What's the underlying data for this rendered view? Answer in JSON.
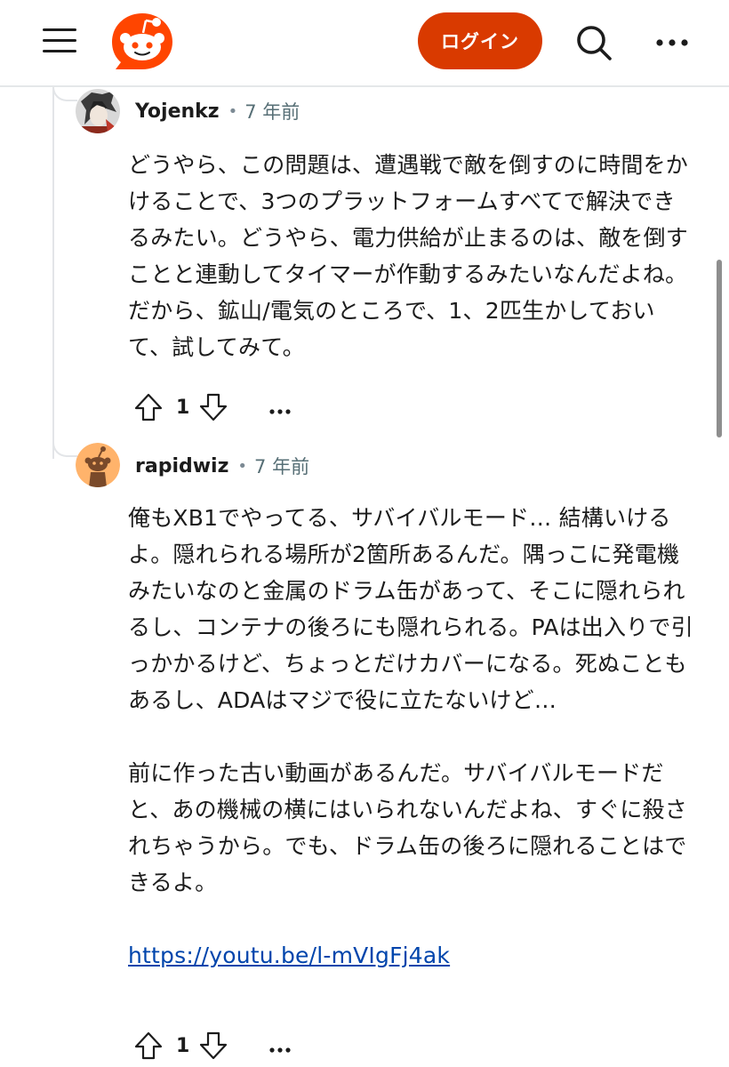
{
  "header": {
    "login_label": "ログイン",
    "icons": {
      "menu": "hamburger-menu-icon",
      "logo": "reddit-logo-icon",
      "search": "search-icon",
      "more": "more-horizontal-icon"
    },
    "colors": {
      "accent": "#d93a00",
      "logo_orange": "#ff4500"
    }
  },
  "comments": [
    {
      "username": "Yojenkz",
      "separator": "•",
      "time": "7 年前",
      "paragraphs": [
        "どうやら、この問題は、遭遇戦で敵を倒すのに時間をかけることで、3つのプラットフォームすべてで解決できるみたい。どうやら、電力供給が止まるのは、敵を倒すことと連動してタイマーが作動するみたいなんだよね。だから、鉱山/電気のところで、1、2匹生かしておいて、試してみて。"
      ],
      "link": "",
      "score": "1"
    },
    {
      "username": "rapidwiz",
      "separator": "•",
      "time": "7 年前",
      "paragraphs": [
        "俺もXB1でやってる、サバイバルモード… 結構いけるよ。隠れられる場所が2箇所あるんだ。隅っこに発電機みたいなのと金属のドラム缶があって、そこに隠れられるし、コンテナの後ろにも隠れられる。PAは出入りで引っかかるけど、ちょっとだけカバーになる。死ぬこともあるし、ADAはマジで役に立たないけど…",
        "前に作った古い動画があるんだ。サバイバルモードだと、あの機械の横にはいられないんだよね、すぐに殺されちゃうから。でも、ドラム缶の後ろに隠れることはできるよ。"
      ],
      "link": "https://youtu.be/l-mVIgFj4ak",
      "score": "1"
    }
  ]
}
